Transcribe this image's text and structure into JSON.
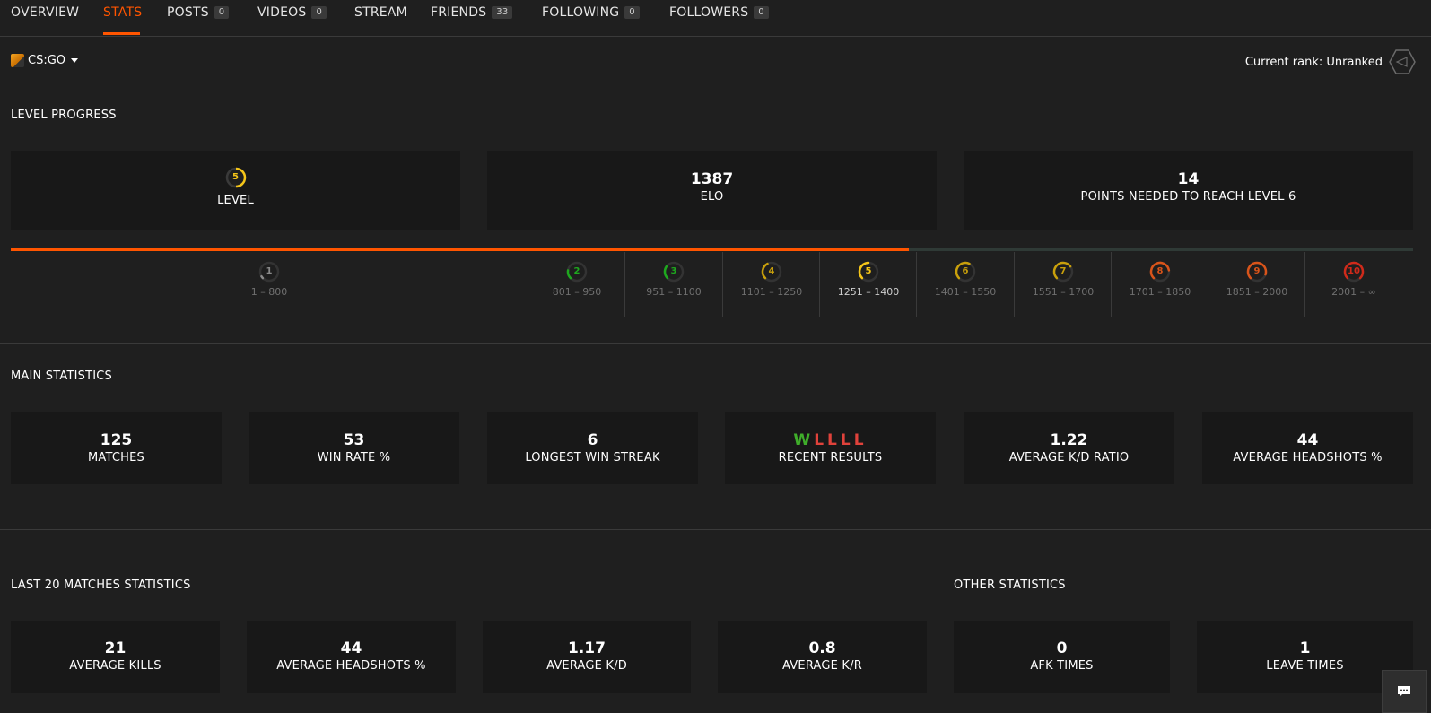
{
  "nav": {
    "items": [
      {
        "label": "OVERVIEW"
      },
      {
        "label": "STATS"
      },
      {
        "label": "POSTS",
        "badge": "0"
      },
      {
        "label": "VIDEOS",
        "badge": "0"
      },
      {
        "label": "STREAM"
      },
      {
        "label": "FRIENDS",
        "badge": "33"
      },
      {
        "label": "FOLLOWING",
        "badge": "0"
      },
      {
        "label": "FOLLOWERS",
        "badge": "0"
      }
    ],
    "active": "STATS"
  },
  "game_select": {
    "label": "CS:GO"
  },
  "rank": {
    "text": "Current rank: Unranked"
  },
  "level_progress": {
    "title": "LEVEL PROGRESS",
    "level": {
      "value": "5",
      "label": "LEVEL"
    },
    "elo": {
      "value": "1387",
      "label": "ELO"
    },
    "points": {
      "value": "14",
      "label": "POINTS NEEDED TO REACH LEVEL 6"
    },
    "progress_fraction": 0.6405,
    "levels": [
      {
        "num": "1",
        "range": "1 – 800",
        "color": "#8a8a8a",
        "fill": 0.05
      },
      {
        "num": "2",
        "range": "801 – 950",
        "color": "#1ea81e",
        "fill": 0.2
      },
      {
        "num": "3",
        "range": "951 – 1100",
        "color": "#1ea81e",
        "fill": 0.3
      },
      {
        "num": "4",
        "range": "1101 – 1250",
        "color": "#c9a00b",
        "fill": 0.4
      },
      {
        "num": "5",
        "range": "1251 – 1400",
        "color": "#f5c518",
        "fill": 0.5
      },
      {
        "num": "6",
        "range": "1401 – 1550",
        "color": "#c9a00b",
        "fill": 0.6
      },
      {
        "num": "7",
        "range": "1551 – 1700",
        "color": "#c9a00b",
        "fill": 0.7
      },
      {
        "num": "8",
        "range": "1701 – 1850",
        "color": "#d9541a",
        "fill": 0.8
      },
      {
        "num": "9",
        "range": "1851 – 2000",
        "color": "#d9541a",
        "fill": 0.9
      },
      {
        "num": "10",
        "range": "2001 – ∞",
        "color": "#d02a1a",
        "fill": 1.0
      }
    ],
    "current_level": "5"
  },
  "main_statistics": {
    "title": "MAIN STATISTICS",
    "cards": [
      {
        "value": "125",
        "label": "MATCHES"
      },
      {
        "value": "53",
        "label": "WIN RATE %"
      },
      {
        "value": "6",
        "label": "LONGEST WIN STREAK"
      },
      {
        "value": "",
        "label": "RECENT RESULTS"
      },
      {
        "value": "1.22",
        "label": "AVERAGE K/D RATIO"
      },
      {
        "value": "44",
        "label": "AVERAGE HEADSHOTS %"
      }
    ],
    "recent_results": [
      "W",
      "L",
      "L",
      "L",
      "L"
    ],
    "colors": {
      "win": "#3fae2a",
      "loss": "#e0423b"
    }
  },
  "last20": {
    "title": "LAST 20 MATCHES STATISTICS",
    "cards": [
      {
        "value": "21",
        "label": "AVERAGE KILLS"
      },
      {
        "value": "44",
        "label": "AVERAGE HEADSHOTS %"
      },
      {
        "value": "1.17",
        "label": "AVERAGE K/D"
      },
      {
        "value": "0.8",
        "label": "AVERAGE K/R"
      }
    ]
  },
  "other": {
    "title": "OTHER STATISTICS",
    "cards": [
      {
        "value": "0",
        "label": "AFK TIMES"
      },
      {
        "value": "1",
        "label": "LEAVE TIMES"
      }
    ]
  },
  "colors": {
    "accent": "#ff5500",
    "background": "#1f1f1f",
    "card": "#181818"
  }
}
